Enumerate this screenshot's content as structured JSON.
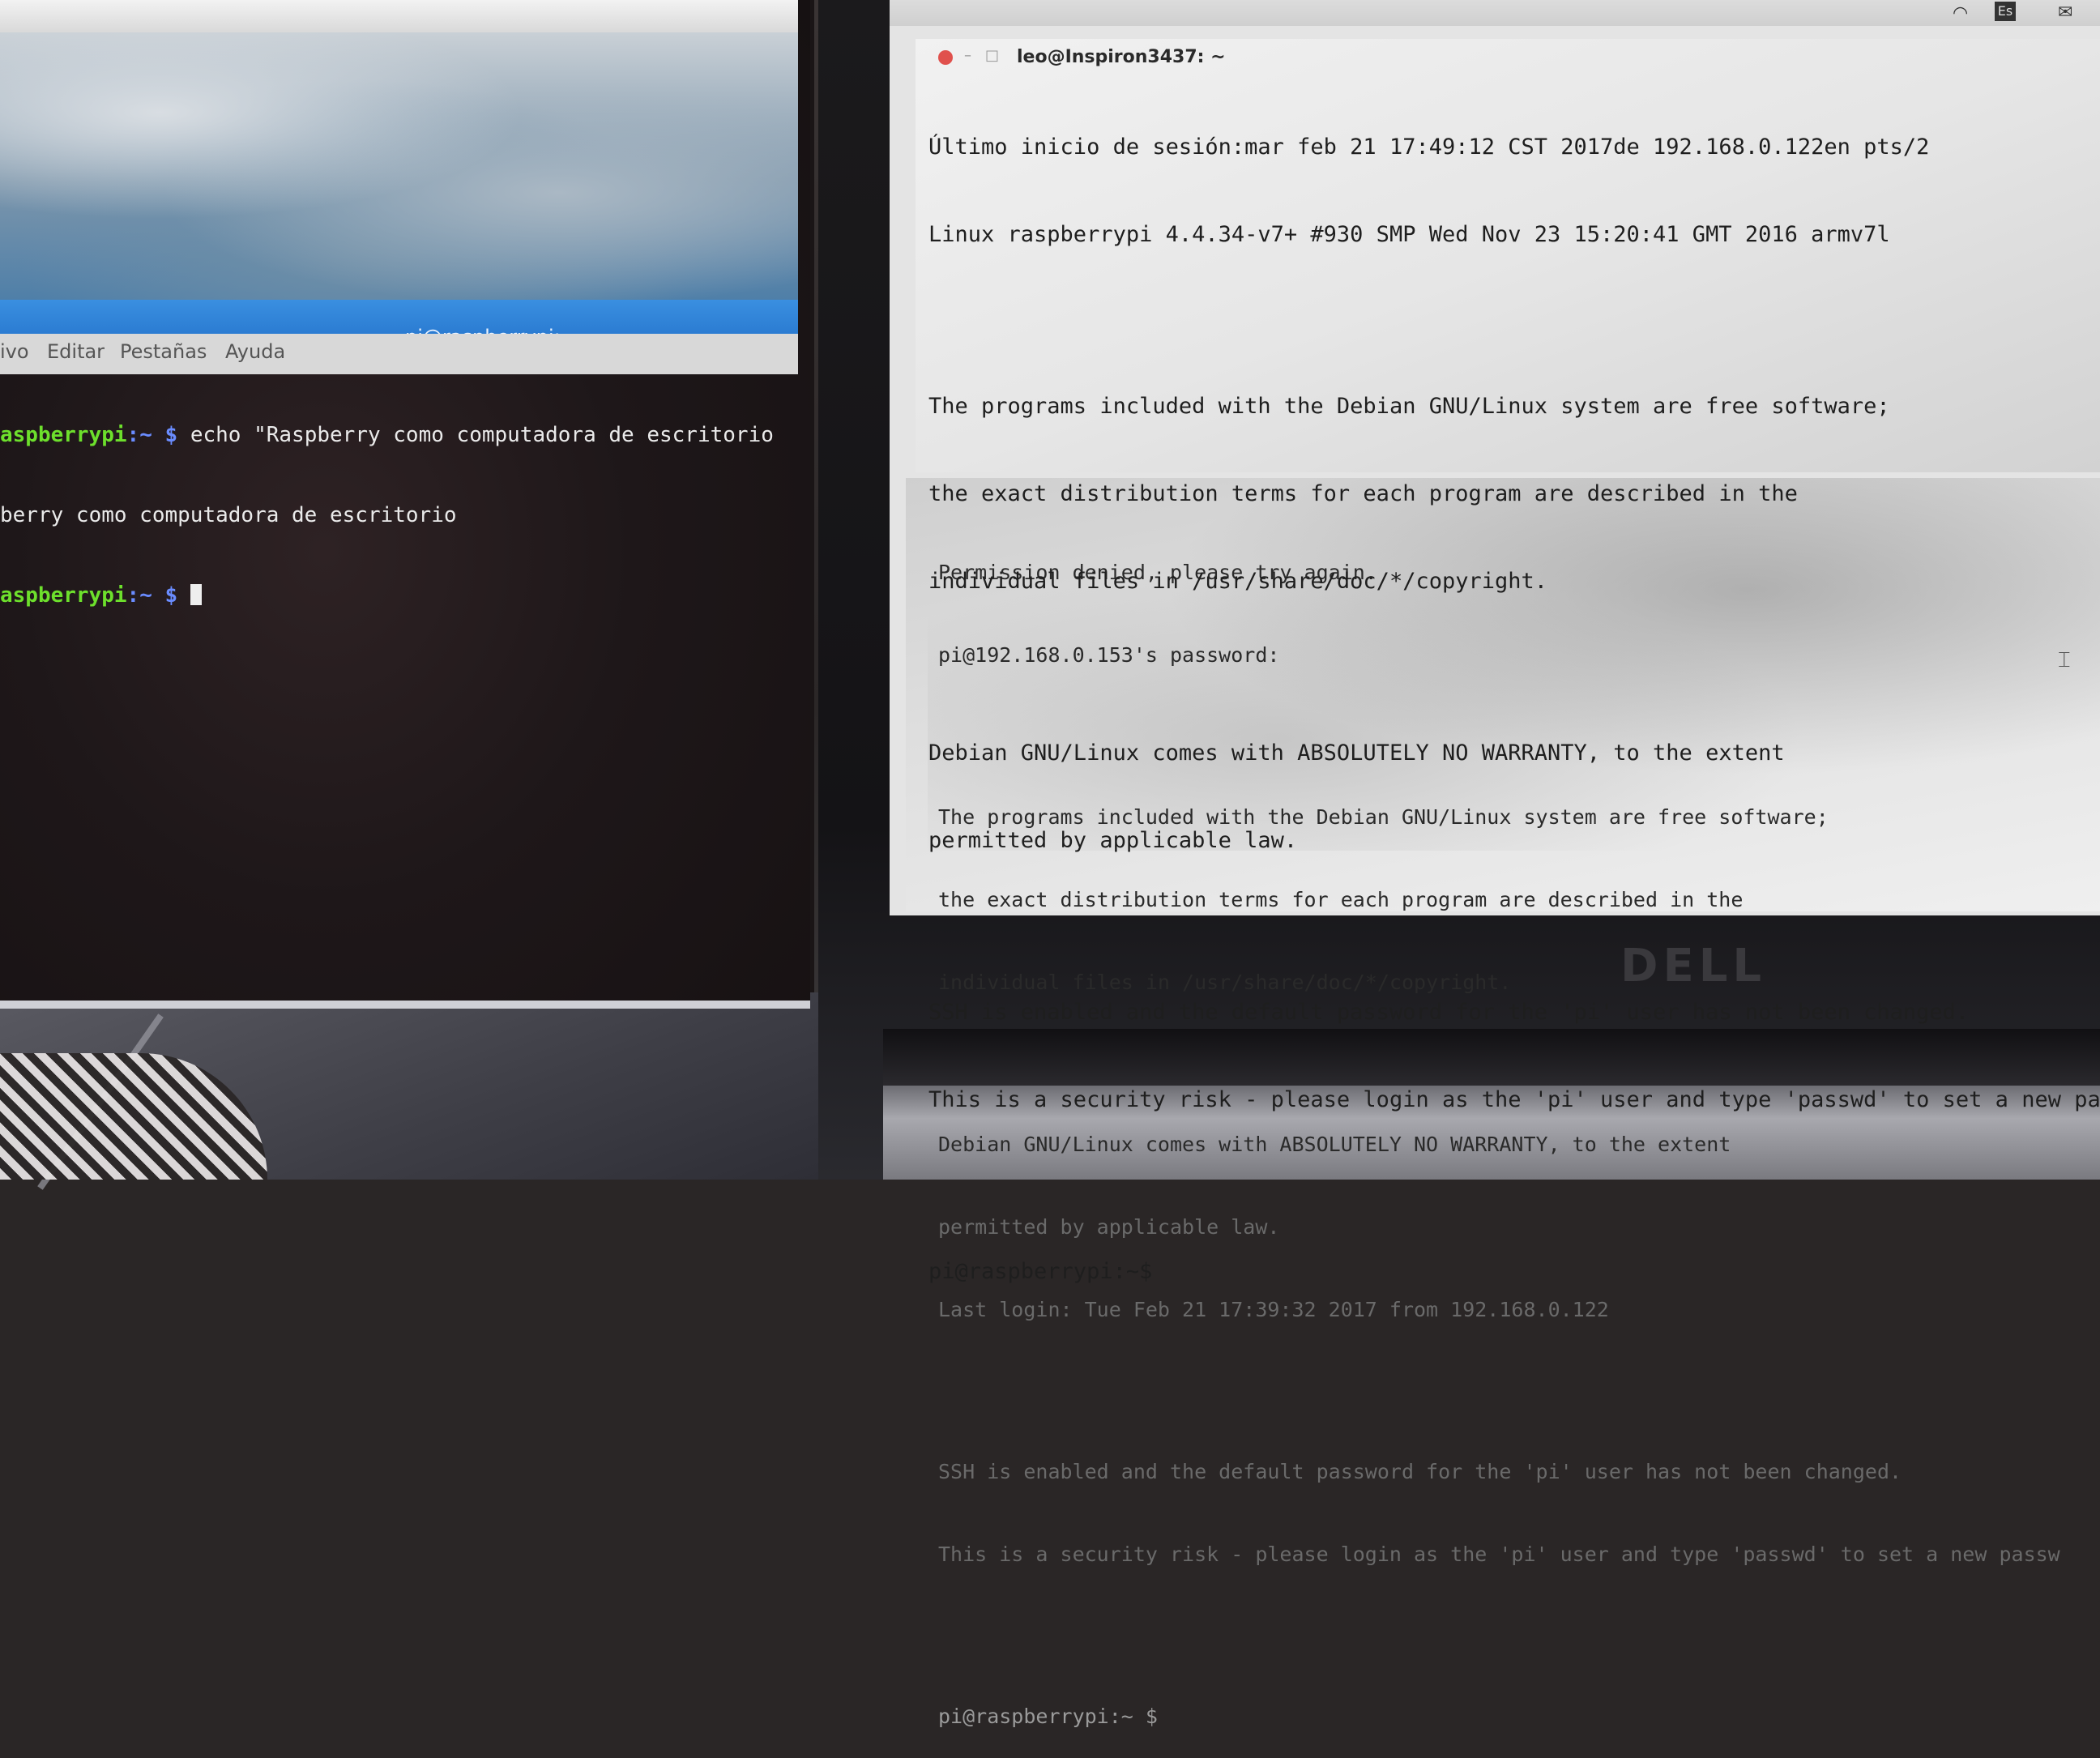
{
  "left_screen": {
    "window_title": "pi@raspberrypi: ~",
    "menu": [
      "ivo",
      "Editar",
      "Pestañas",
      "Ayuda"
    ],
    "terminal_lines": [
      {
        "user": "aspberrypi",
        "path": ":~ $",
        "cmd": " echo \"Raspberry como computadora de escritorio"
      },
      {
        "text": "berry como computadora de escritorio"
      },
      {
        "user": "aspberrypi",
        "path": ":~ $",
        "cmd": " "
      }
    ]
  },
  "laptop": {
    "brand": "DELL",
    "tray_keyboard": "Es",
    "terminal1": {
      "title": "leo@Inspiron3437: ~",
      "lines": [
        "Último inicio de sesión:mar feb 21 17:49:12 CST 2017de 192.168.0.122en pts/2",
        "Linux raspberrypi 4.4.34-v7+ #930 SMP Wed Nov 23 15:20:41 GMT 2016 armv7l",
        "",
        "The programs included with the Debian GNU/Linux system are free software;",
        "the exact distribution terms for each program are described in the",
        "individual files in /usr/share/doc/*/copyright.",
        "",
        "Debian GNU/Linux comes with ABSOLUTELY NO WARRANTY, to the extent",
        "permitted by applicable law.",
        "",
        "SSH is enabled and the default password for the 'pi' user has not been changed.",
        "This is a security risk - please login as the 'pi' user and type 'passwd' to set a new pa",
        "",
        "pi@raspberrypi:~$ "
      ]
    },
    "terminal2": {
      "lines": [
        "Permission denied, please try again.",
        "pi@192.168.0.153's password:",
        "",
        "The programs included with the Debian GNU/Linux system are free software;",
        "the exact distribution terms for each program are described in the",
        "individual files in /usr/share/doc/*/copyright.",
        "",
        "Debian GNU/Linux comes with ABSOLUTELY NO WARRANTY, to the extent",
        "permitted by applicable law.",
        "Last login: Tue Feb 21 17:39:32 2017 from 192.168.0.122",
        "",
        "SSH is enabled and the default password for the 'pi' user has not been changed.",
        "This is a security risk - please login as the 'pi' user and type 'passwd' to set a new passw",
        "",
        "pi@raspberrypi:~ $ "
      ]
    }
  }
}
